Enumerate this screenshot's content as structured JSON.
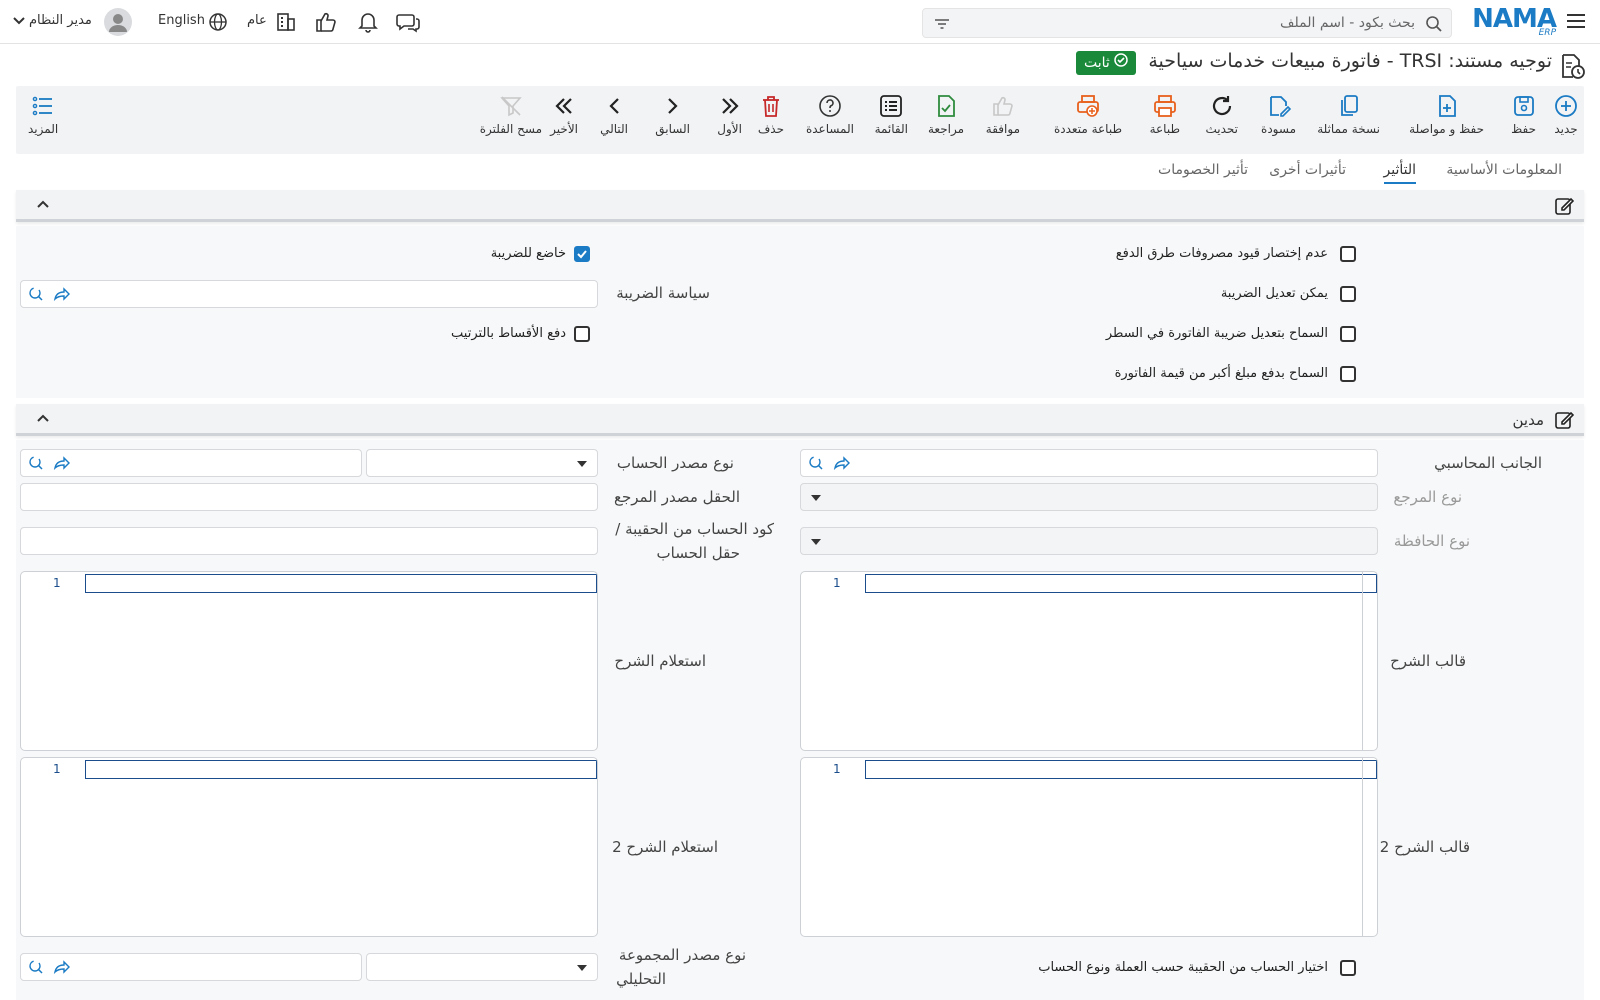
{
  "topbar": {
    "logo_text": "NAMA",
    "logo_sub": "ERP",
    "search_placeholder": "بحث بكود - اسم الملف",
    "company_label": "عام",
    "language_label": "English",
    "user_label": "مدير النظام"
  },
  "document": {
    "title": "توجيه مستند: TRSI - فاتورة مبيعات خدمات سياحية",
    "status_badge": "ثابت"
  },
  "toolbar": {
    "new": "جديد",
    "save": "حفظ",
    "save_continue": "حفظ و مواصلة",
    "duplicate": "نسخة مماثلة",
    "draft": "مسودة",
    "refresh": "تحديث",
    "print": "طباعة",
    "multi_print": "طباعة متعددة",
    "approve": "موافقة",
    "review": "مراجعة",
    "list": "القائمة",
    "help": "المساعدة",
    "delete": "حذف",
    "first": "الأول",
    "previous": "السابق",
    "next": "التالي",
    "last": "الأخير",
    "clear_filter": "مسح الفلترة",
    "more": "المزيد"
  },
  "tabs": [
    {
      "label": "المعلومات الأساسية",
      "active": false
    },
    {
      "label": "التأثير",
      "active": true
    },
    {
      "label": "تأثيرات أخرى",
      "active": false
    },
    {
      "label": "تأثير الخصومات",
      "active": false
    }
  ],
  "section1": {
    "no_shorten_payment": "عدم إختصار قيود مصروفات طرق الدفع",
    "subject_to_tax": "خاضع للضريبة",
    "subject_to_tax_checked": true,
    "can_edit_tax": "يمكن تعديل الضريبة",
    "tax_policy_label": "سياسة الضريبة",
    "allow_line_tax_edit": "السماح بتعديل ضريبة الفاتورة في السطر",
    "pay_installments_in_order": "دفع الأقساط بالترتيب",
    "allow_overpay": "السماح بدفع مبلغ أكبر من قيمة الفاتورة"
  },
  "section2": {
    "title": "مدين",
    "accounting_side": "الجانب المحاسبي",
    "account_source_type": "نوع مصدر الحساب",
    "reference_type": "نوع المرجع",
    "reference_source_field": "الحقل مصدر المرجع",
    "portfolio_type": "نوع الحافظة",
    "account_code_from_bag_1": "كود الحساب من الحقيبة /",
    "account_code_from_bag_2": "حقل الحساب",
    "description_template": "قالب الشرح",
    "description_query": "استعلام الشرح",
    "description_template_2": "قالب الشرح 2",
    "description_query_2": "استعلام الشرح 2",
    "line_number": "1",
    "analytic_group_source_1": "نوع مصدر المجموعة",
    "analytic_group_source_2": "التحليلي",
    "choose_account_from_bag": "اختيار الحساب من الحقيبة حسب العملة ونوع الحساب"
  },
  "colors": {
    "accent": "#1b7bc4",
    "badge": "#1a8a3a",
    "print_orange": "#e8601c",
    "delete_red": "#c62828",
    "review_green": "#2e8b3d"
  }
}
